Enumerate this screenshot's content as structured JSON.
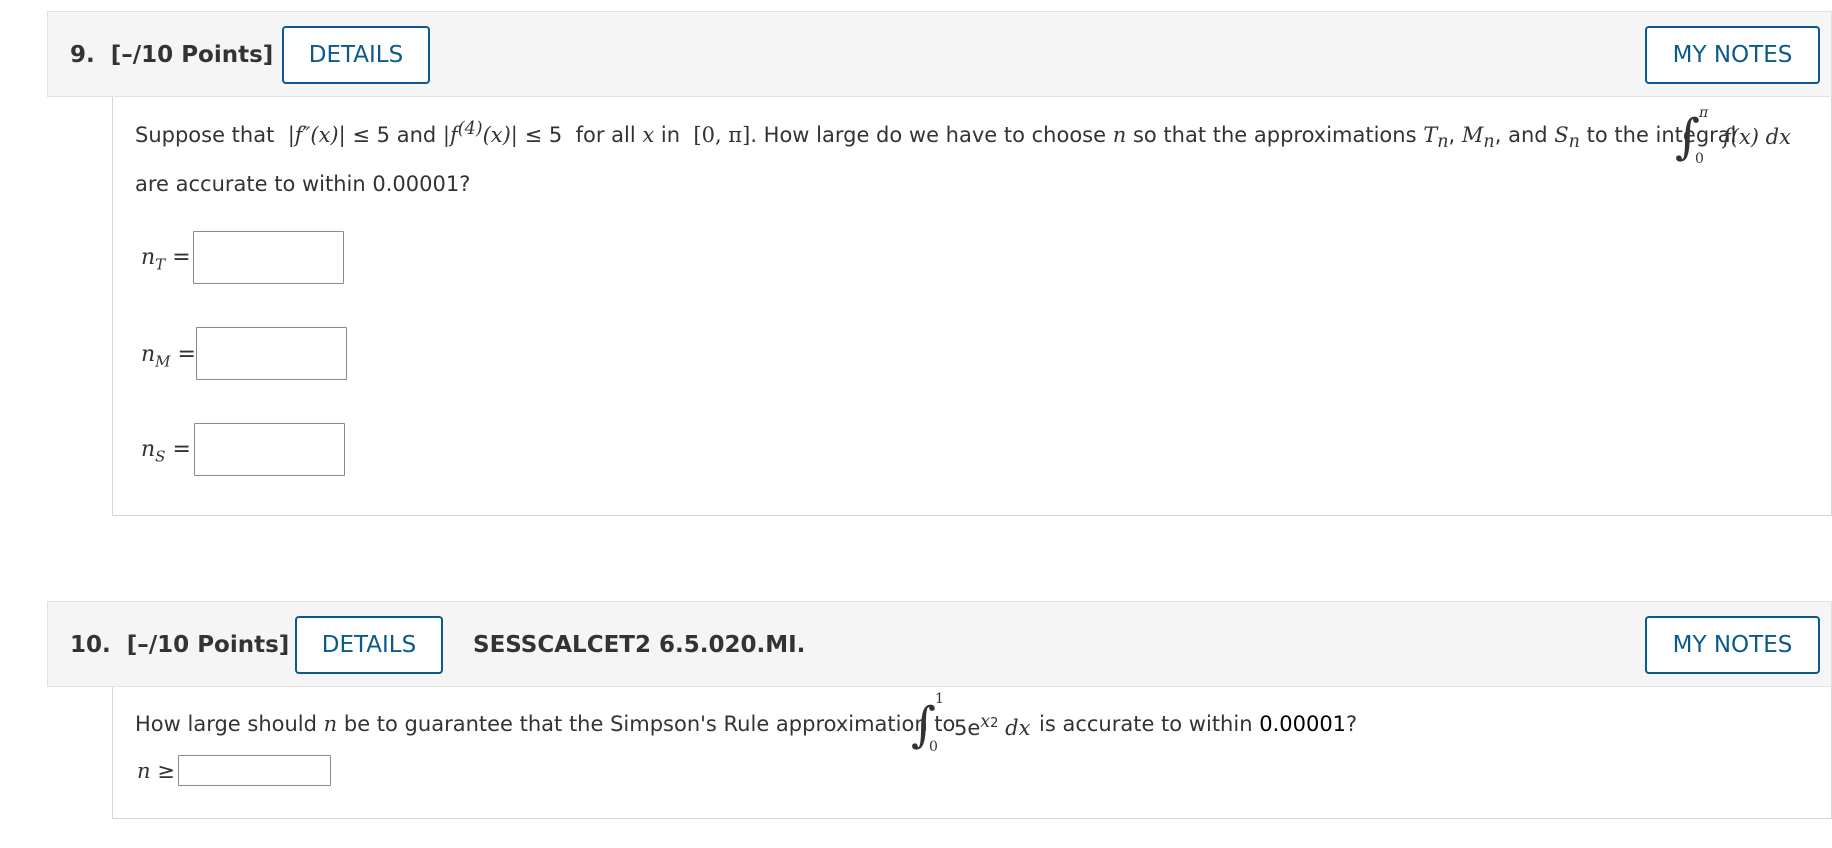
{
  "questions": [
    {
      "number": "9.",
      "points": "[–/10 Points]",
      "details_label": "DETAILS",
      "notes_label": "MY NOTES",
      "prompt": {
        "intro": "Suppose that",
        "cond1_lhs": "|f″(x)|",
        "cond1_rel": "≤ 5",
        "and1": "and",
        "cond2_pre": "|f",
        "cond2_sup": "(4)",
        "cond2_post": "(x)|",
        "cond2_rel": "≤ 5",
        "for_all": "for all",
        "var_x": "x",
        "in_word": "in",
        "interval": "[0, π]",
        "middle": ". How large do we have to choose",
        "var_n": "n",
        "so_that": "so that the approximations",
        "T": "T",
        "M": "M",
        "S": "S",
        "sub_n": "n",
        "comma": ",",
        "and2": "and",
        "to_integral": "to the integral",
        "int_upper": "π",
        "int_lower": "0",
        "integrand": "f(x) dx",
        "line2": "are accurate to within 0.00001?"
      },
      "answers": [
        {
          "var": "n",
          "sub": "T",
          "eq": "=",
          "value": ""
        },
        {
          "var": "n",
          "sub": "M",
          "eq": "=",
          "value": ""
        },
        {
          "var": "n",
          "sub": "S",
          "eq": "=",
          "value": ""
        }
      ]
    },
    {
      "number": "10.",
      "points": "[–/10 Points]",
      "details_label": "DETAILS",
      "source_id": "SESSCALCET2 6.5.020.MI.",
      "notes_label": "MY NOTES",
      "prompt": {
        "pre": "How large should",
        "var_n": "n",
        "mid": "be to guarantee that the Simpson's Rule approximation to",
        "int_upper": "1",
        "int_lower": "0",
        "coef": "5e",
        "exp_base": "x",
        "exp_pow": "2",
        "dx": "dx",
        "post": "is accurate to within",
        "tolerance": "0.00001",
        "qmark": "?"
      },
      "answer": {
        "var": "n",
        "rel": "≥",
        "value": ""
      }
    }
  ]
}
